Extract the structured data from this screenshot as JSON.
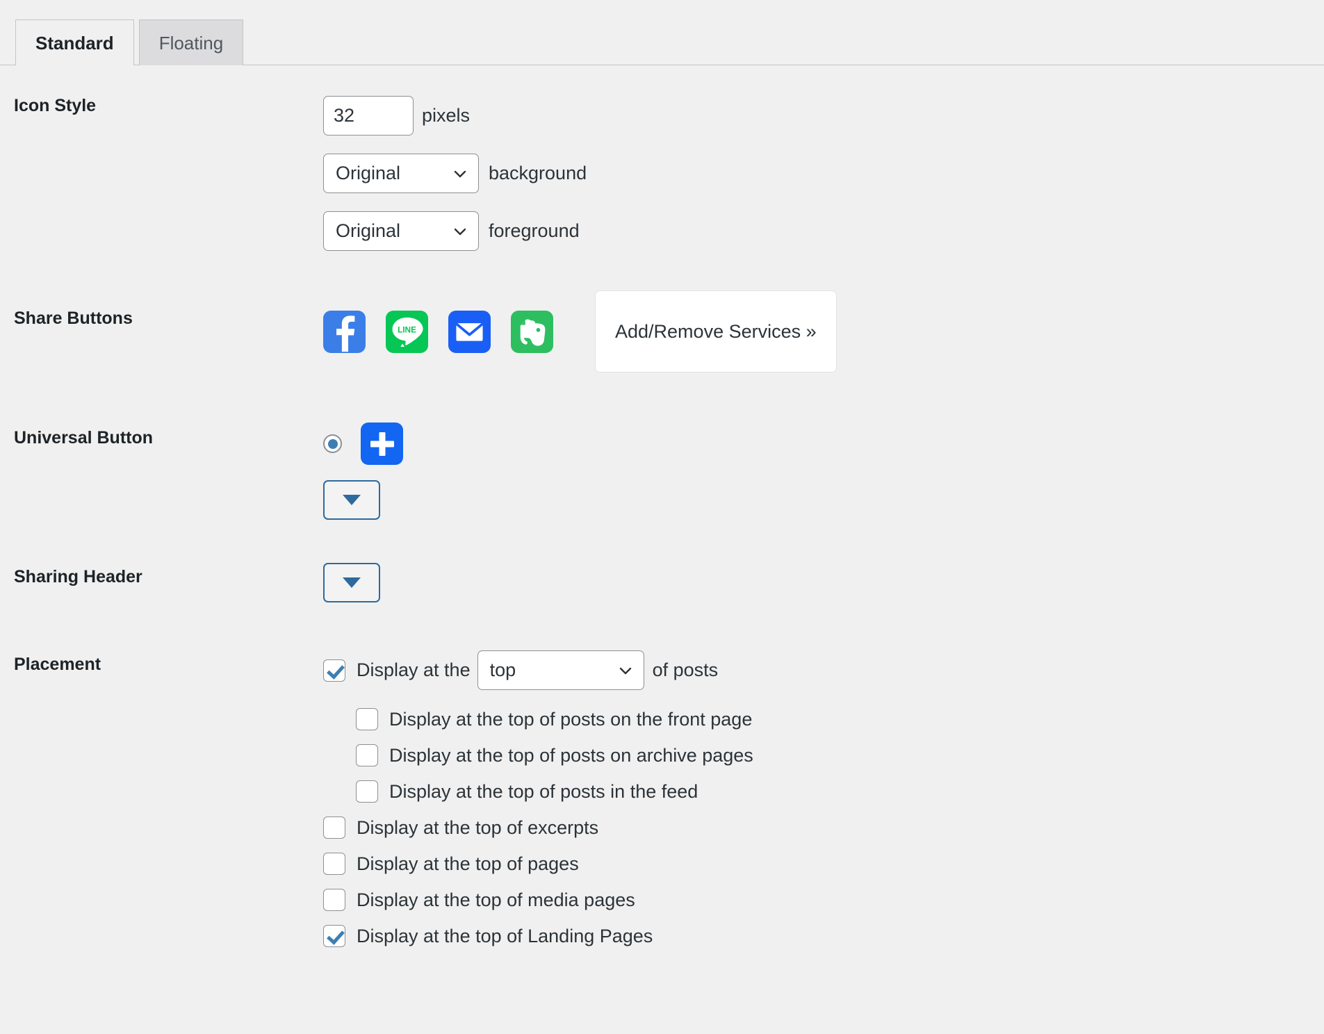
{
  "tabs": [
    {
      "label": "Standard",
      "active": true
    },
    {
      "label": "Floating",
      "active": false
    }
  ],
  "sections": {
    "icon_style": {
      "label": "Icon Style",
      "size_value": "32",
      "size_unit": "pixels",
      "background_select": "Original",
      "background_label": "background",
      "foreground_select": "Original",
      "foreground_label": "foreground"
    },
    "share_buttons": {
      "label": "Share Buttons",
      "icons": [
        {
          "name": "facebook",
          "color": "#3b7ee8"
        },
        {
          "name": "line",
          "color": "#06c755"
        },
        {
          "name": "email",
          "color": "#1a5ff5"
        },
        {
          "name": "evernote",
          "color": "#2dbe60"
        }
      ],
      "add_remove_label": "Add/Remove Services »"
    },
    "universal_button": {
      "label": "Universal Button",
      "radio_selected": true,
      "plus_color": "#1266f1"
    },
    "sharing_header": {
      "label": "Sharing Header"
    },
    "placement": {
      "label": "Placement",
      "first_row": {
        "checked": true,
        "text_before": "Display at the",
        "select_value": "top",
        "text_after": "of posts"
      },
      "nested_items": [
        {
          "checked": false,
          "label": "Display at the top of posts on the front page"
        },
        {
          "checked": false,
          "label": "Display at the top of posts on archive pages"
        },
        {
          "checked": false,
          "label": "Display at the top of posts in the feed"
        }
      ],
      "items": [
        {
          "checked": false,
          "label": "Display at the top of excerpts"
        },
        {
          "checked": false,
          "label": "Display at the top of pages"
        },
        {
          "checked": false,
          "label": "Display at the top of media pages"
        },
        {
          "checked": true,
          "label": "Display at the top of Landing Pages"
        }
      ]
    }
  },
  "colors": {
    "page_bg": "#f0f0f0",
    "accent_blue": "#3b7fb5",
    "border": "#8c8f94"
  }
}
